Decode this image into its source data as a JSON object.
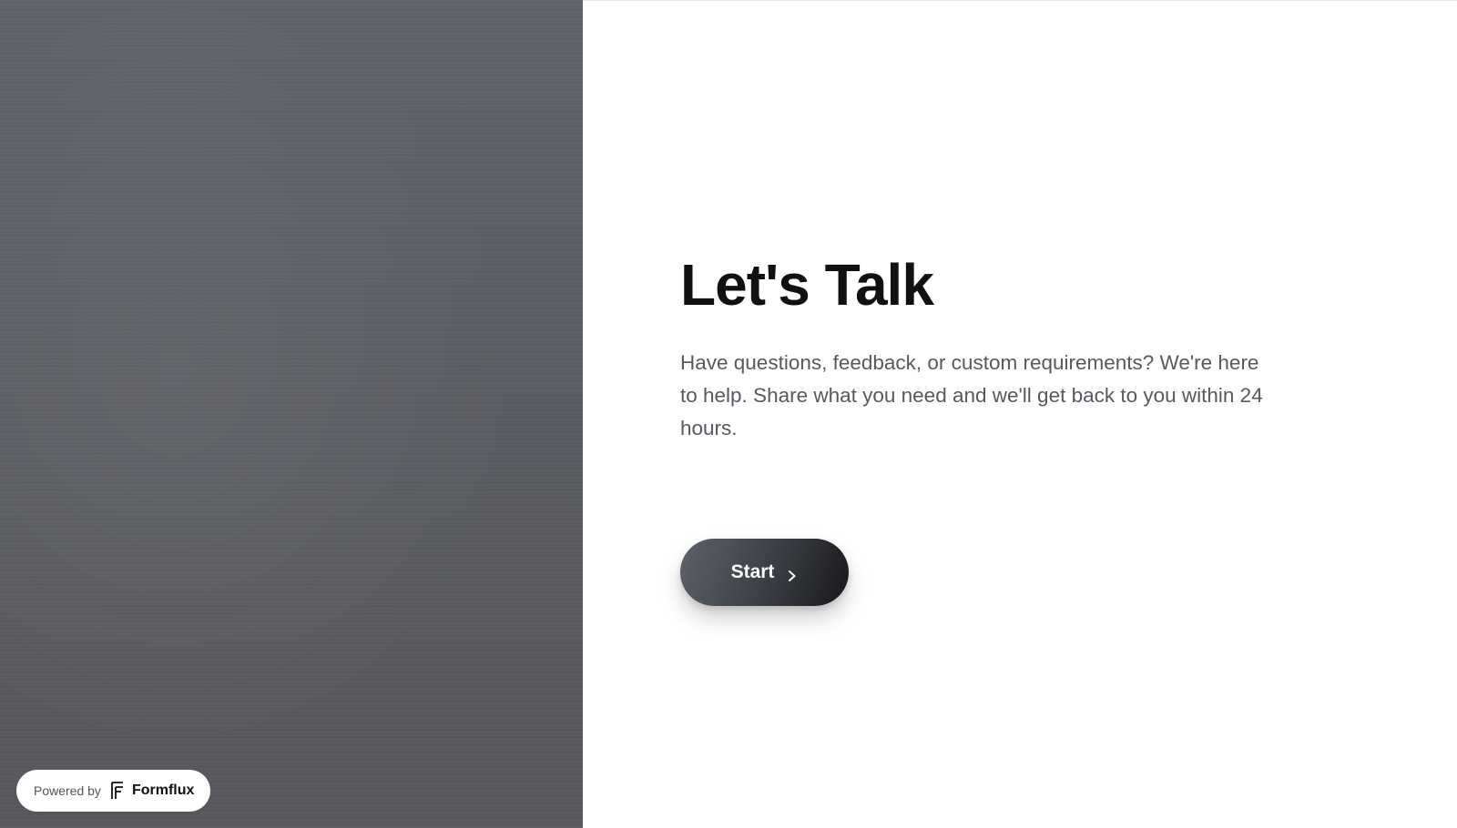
{
  "hero": {
    "title": "Let's Talk",
    "description": "Have questions, feedback, or custom requirements? We're here to help. Share what you need and we'll get back to you within 24 hours."
  },
  "start_button": {
    "label": "Start",
    "icon": "chevron-right-icon"
  },
  "badge": {
    "powered_by": "Powered by",
    "brand": "Formflux",
    "logo_icon": "formflux-logo-icon"
  },
  "colors": {
    "left_panel": "#5a5d63",
    "title": "#111111",
    "description": "#555a60",
    "button_dark": "#17181a",
    "button_light": "#5d626b"
  }
}
